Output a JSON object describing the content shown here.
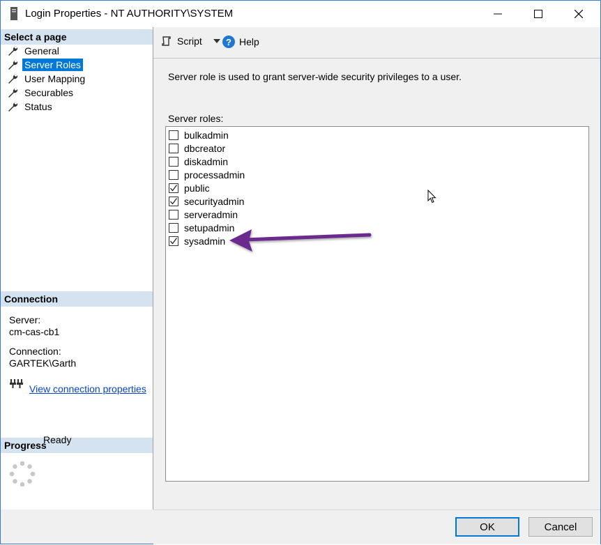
{
  "window": {
    "title": "Login Properties - NT AUTHORITY\\SYSTEM",
    "minimize_glyph": "—",
    "maximize_glyph": "☐",
    "close_glyph": "✕"
  },
  "sidebar": {
    "select_page_header": "Select a page",
    "items": [
      {
        "label": "General",
        "icon": "wrench-icon",
        "selected": false
      },
      {
        "label": "Server Roles",
        "icon": "wrench-icon",
        "selected": true
      },
      {
        "label": "User Mapping",
        "icon": "wrench-icon",
        "selected": false
      },
      {
        "label": "Securables",
        "icon": "wrench-icon",
        "selected": false
      },
      {
        "label": "Status",
        "icon": "wrench-icon",
        "selected": false
      }
    ],
    "connection_header": "Connection",
    "server_label": "Server:",
    "server_value": "cm-cas-cb1",
    "connection_label": "Connection:",
    "connection_value": "GARTEK\\Garth",
    "view_connection_link": "View connection properties",
    "progress_header": "Progress",
    "progress_status": "Ready"
  },
  "toolbar": {
    "script_label": "Script",
    "help_label": "Help",
    "help_glyph": "?"
  },
  "main": {
    "description": "Server role is used to grant server-wide security privileges to a user.",
    "roles_label": "Server roles:",
    "roles": [
      {
        "name": "bulkadmin",
        "checked": false
      },
      {
        "name": "dbcreator",
        "checked": false
      },
      {
        "name": "diskadmin",
        "checked": false
      },
      {
        "name": "processadmin",
        "checked": false
      },
      {
        "name": "public",
        "checked": true
      },
      {
        "name": "securityadmin",
        "checked": true
      },
      {
        "name": "serveradmin",
        "checked": false
      },
      {
        "name": "setupadmin",
        "checked": false
      },
      {
        "name": "sysadmin",
        "checked": true
      }
    ]
  },
  "footer": {
    "ok_label": "OK",
    "cancel_label": "Cancel"
  },
  "colors": {
    "selection": "#0078d7",
    "section_header": "#d5e2ef",
    "annotation_arrow": "#6a2c8e",
    "link": "#0645c8"
  }
}
